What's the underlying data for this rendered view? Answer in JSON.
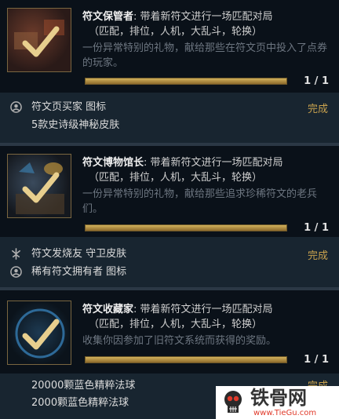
{
  "quests": [
    {
      "name": "符文保管者",
      "objective": ": 带着新符文进行一场匹配对局",
      "modes": "（匹配，排位，人机，大乱斗，轮换）",
      "description": "一份异常特别的礼物，献给那些在符文页中投入了点券的玩家。",
      "progress": 1,
      "count": "1 / 1",
      "status": "完成",
      "rewards": [
        {
          "icon": "user-circle-icon",
          "label": "符文页买家 图标"
        },
        {
          "icon": "",
          "label": "5款史诗级神秘皮肤"
        }
      ]
    },
    {
      "name": "符文博物馆长",
      "objective": ": 带着新符文进行一场匹配对局",
      "modes": "（匹配，排位，人机，大乱斗，轮换）",
      "description": "一份异常特别的礼物，献给那些追求珍稀符文的老兵们。",
      "progress": 1,
      "count": "1 / 1",
      "status": "完成",
      "rewards": [
        {
          "icon": "champion-skin-icon",
          "label": "符文发烧友 守卫皮肤"
        },
        {
          "icon": "user-circle-icon",
          "label": "稀有符文拥有者 图标"
        }
      ]
    },
    {
      "name": "符文收藏家",
      "objective": ": 带着新符文进行一场匹配对局",
      "modes": "（匹配，排位，人机，大乱斗，轮换）",
      "description": "收集你因参加了旧符文系统而获得的奖励。",
      "progress": 1,
      "count": "1 / 1",
      "status": "完成",
      "rewards": [
        {
          "icon": "",
          "label": "20000颗蓝色精粹法球"
        },
        {
          "icon": "",
          "label": "2000颗蓝色精粹法球"
        }
      ]
    }
  ],
  "watermark": {
    "name": "铁骨网",
    "url": "www.TieGu.com"
  },
  "colors": {
    "accent_gold": "#c9a24e",
    "progress_fill": "#b8964a",
    "background": "#0d1620"
  }
}
